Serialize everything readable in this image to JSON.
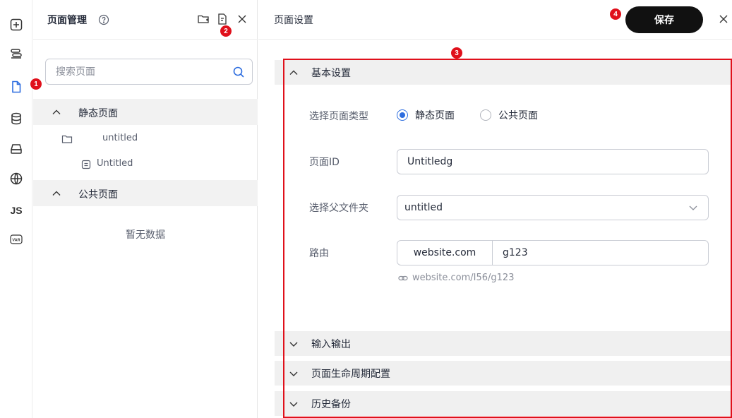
{
  "panel": {
    "title": "页面管理",
    "search_placeholder": "搜索页面",
    "groups": {
      "static": {
        "label": "静态页面",
        "folder_label": "untitled",
        "file_label": "Untitled"
      },
      "public": {
        "label": "公共页面",
        "empty_text": "暂无数据"
      }
    }
  },
  "rail": {
    "items": [
      "add-icon",
      "layers-icon",
      "page-icon",
      "database-icon",
      "drive-icon",
      "globe-icon",
      "js-icon",
      "var-icon"
    ],
    "js_label": "JS",
    "var_label": "VAR"
  },
  "settings": {
    "title": "页面设置",
    "save_label": "保存",
    "sections": {
      "basic": "基本设置",
      "io": "输入输出",
      "lifecycle": "页面生命周期配置",
      "history": "历史备份"
    },
    "form": {
      "page_type_label": "选择页面类型",
      "page_type_options": [
        "静态页面",
        "公共页面"
      ],
      "page_type_selected": "静态页面",
      "page_id_label": "页面ID",
      "page_id_value": "Untitledg",
      "parent_folder_label": "选择父文件夹",
      "parent_folder_value": "untitled",
      "route_label": "路由",
      "route_prefix": "website.com",
      "route_value": "g123",
      "route_preview": "website.com/I56/g123"
    }
  },
  "annotations": {
    "badges": [
      "1",
      "2",
      "3",
      "4"
    ],
    "color": "#e0101b"
  },
  "colors": {
    "accent": "#2d6ddf",
    "save_button_bg": "#111111"
  }
}
